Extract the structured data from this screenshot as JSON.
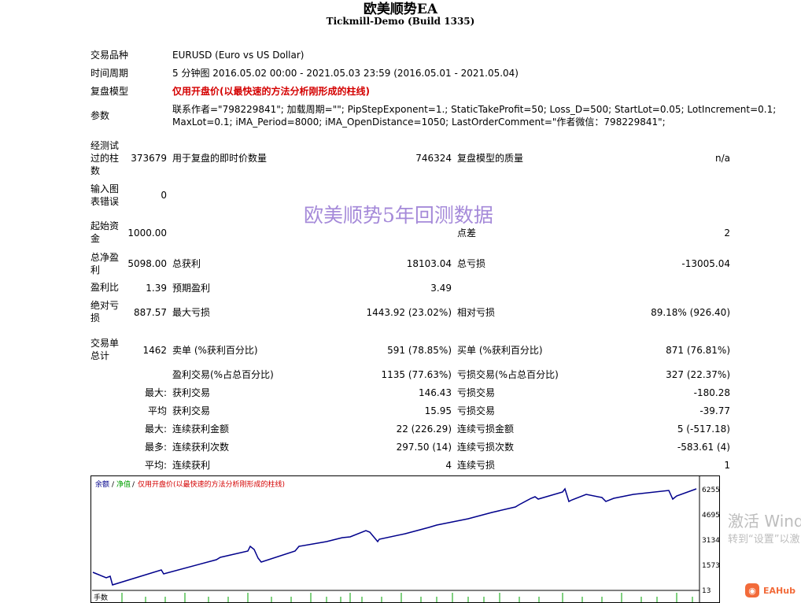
{
  "header": {
    "title": "欧美顺势EA",
    "subtitle": "Tickmill-Demo (Build 1335)"
  },
  "watermark": "欧美顺势5年回测数据",
  "info": {
    "symbol_label": "交易品种",
    "symbol_value": "EURUSD (Euro vs US Dollar)",
    "period_label": "时间周期",
    "period_value": "5 分钟图 2016.05.02 00:00 - 2021.05.03 23:59 (2016.05.01 - 2021.05.04)",
    "model_label": "复盘模型",
    "model_value": "仅用开盘价(以最快速的方法分析刚形成的柱线)",
    "params_label": "参数",
    "params_line1": "联系作者=\"798229841\"; 加载周期=\"\"; PipStepExponent=1.; StaticTakeProfit=50; Loss_D=500; StartLot=0.05; LotIncrement=0.1;",
    "params_line2": "MaxLot=0.1; iMA_Period=8000; iMA_OpenDistance=1050; LastOrderComment=\"作者微信：798229841\";"
  },
  "stats": {
    "bars_label_1": "经测试",
    "bars_label_2": "过的柱",
    "bars_label_3": "数",
    "bars_value": "373679",
    "ticks_label": "用于复盘的即时价数量",
    "ticks_value": "746324",
    "quality_label": "复盘模型的质量",
    "quality_value": "n/a",
    "errors_label_1": "输入图",
    "errors_label_2": "表错误",
    "errors_value": "0",
    "deposit_label_1": "起始资",
    "deposit_label_2": "金",
    "deposit_value": "1000.00",
    "spread_label": "点差",
    "spread_value": "2",
    "net_label_1": "总净盈",
    "net_label_2": "利",
    "net_value": "5098.00",
    "gross_profit_label": "总获利",
    "gross_profit_value": "18103.04",
    "gross_loss_label": "总亏损",
    "gross_loss_value": "-13005.04",
    "pf_label": "盈利比",
    "pf_value": "1.39",
    "payoff_label": "预期盈利",
    "payoff_value": "3.49",
    "abs_dd_label_1": "绝对亏",
    "abs_dd_label_2": "损",
    "abs_dd_value": "887.57",
    "max_dd_label": "最大亏损",
    "max_dd_value": "1443.92 (23.02%)",
    "rel_dd_label": "相对亏损",
    "rel_dd_value": "89.18% (926.40)",
    "trades_label_1": "交易单",
    "trades_label_2": "总计",
    "trades_value": "1462",
    "short_label": "卖单 (%获利百分比)",
    "short_value": "591 (78.85%)",
    "long_label": "买单 (%获利百分比)",
    "long_value": "871 (76.81%)",
    "profit_trades_label": "盈利交易(%占总百分比)",
    "profit_trades_value": "1135 (77.63%)",
    "loss_trades_label": "亏损交易(%占总百分比)",
    "loss_trades_value": "327 (22.37%)",
    "largest_prefix": "最大:",
    "largest_profit_label": "获利交易",
    "largest_profit_value": "146.43",
    "largest_loss_label": "亏损交易",
    "largest_loss_value": "-180.28",
    "average_prefix": "平均",
    "average_profit_label": "获利交易",
    "average_profit_value": "15.95",
    "average_loss_label": "亏损交易",
    "average_loss_value": "-39.77",
    "max1_prefix": "最大:",
    "consec_wins_label": "连续获利金额",
    "consec_wins_value": "22 (226.29)",
    "consec_losses_label": "连续亏损金额",
    "consec_losses_value": "5 (-517.18)",
    "max2_prefix": "最多:",
    "consec_profit_label": "连续获利次数",
    "consec_profit_value": "297.50 (14)",
    "consec_loss_label": "连续亏损次数",
    "consec_loss_value": "-583.61 (4)",
    "avg2_prefix": "平均:",
    "avg_consec_wins_label": "连续获利",
    "avg_consec_wins_value": "4",
    "avg_consec_losses_label": "连续亏损",
    "avg_consec_losses_value": "1"
  },
  "chart": {
    "legend_balance": "余额",
    "legend_sep1": "/",
    "legend_equity": "净值",
    "legend_sep2": "/",
    "legend_model": "仅用开盘价(以最快速的方法分析刚形成的柱线)",
    "yticks": [
      "6255",
      "4695",
      "3134",
      "1573",
      "13"
    ],
    "lots_label": "手数",
    "line_color": "#00008b",
    "equity_color": "#00a000"
  },
  "overlay": {
    "activate_line1": "激活 Wind",
    "activate_line2": "转到“设置”以激",
    "brand": "EAHub"
  }
}
